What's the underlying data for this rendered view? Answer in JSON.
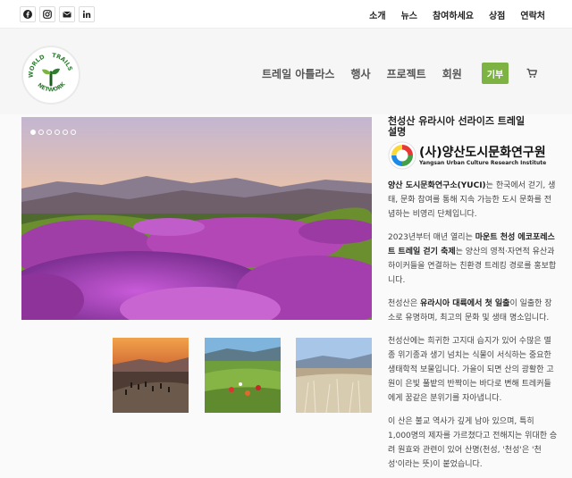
{
  "topbar": {
    "social_icons": [
      "facebook-icon",
      "instagram-icon",
      "email-icon",
      "linkedin-icon"
    ],
    "links": [
      "소개",
      "뉴스",
      "참여하세요",
      "상점",
      "연락처"
    ]
  },
  "header": {
    "logo_text": {
      "top_left": "WORLD",
      "top_right": "TRAILS",
      "bottom": "NETWORK"
    },
    "nav": [
      "트레일 아틀라스",
      "행사",
      "프로젝트",
      "회원"
    ],
    "donate_label": "기부",
    "accent_color": "#7cb342"
  },
  "slider": {
    "slide_count": 6,
    "active_index": 0
  },
  "article": {
    "title": "천성산 유라시아 선라이즈 트레일 설명",
    "org_name": "(사)양산도시문화연구원",
    "org_name_en": "Yangsan Urban Culture Research Institute",
    "p1_bold": "양산 도시문화연구소(YUCI)",
    "p1_text": "는 한국에서 걷기, 생태, 문화 참여를 통해 지속 가능한 도시 문화를 전념하는 비영리 단체입니다.",
    "p2_pre": "2023년부터 매년 열리는 ",
    "p2_bold": "마운트 천성 에코포레스트 트레일 걷기 축제",
    "p2_text": "는 양산의 영적·자연적 유산과 하이커들을 연결하는 친환경 트레킹 경로를 홍보합니다.",
    "p3_pre": "천성산은 ",
    "p3_bold": "유라시아 대륙에서 첫 일출",
    "p3_text": "이 일출한 장소로 유명하며, 최고의 문화 및 생태 명소입니다.",
    "p4": "천성산에는 희귀한 고지대 습지가 있어 수많은 멸종 위기종과 생기 넘치는 식물이 서식하는 중요한 생태학적 보물입니다. 가을이 되면 산의 광활한 고원이 은빛 풀밭의 반짝이는 바다로 변해 트레커들에게 꿈같은 분위기를 자아냅니다.",
    "p5": "이 산은 불교 역사가 깊게 남아 있으며, 특히 1,000명의 제자를 가르쳤다고 전해지는 위대한 승려 원효와 관련이 있어 산명(천성, '천성'은 '천 성'이라는 뜻)이 붙었습니다."
  }
}
